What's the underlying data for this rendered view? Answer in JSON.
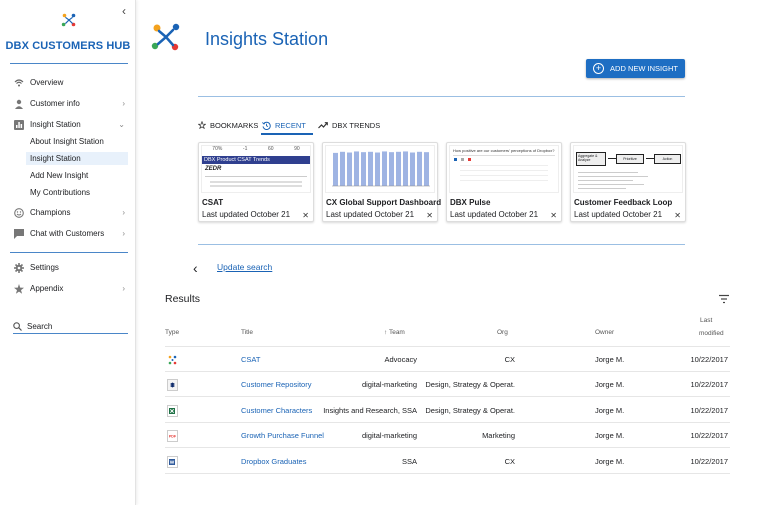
{
  "sidebar": {
    "title": "DBX CUSTOMERS HUB",
    "items": [
      {
        "label": "Overview",
        "icon": "wifi-icon"
      },
      {
        "label": "Customer info",
        "icon": "person-icon"
      },
      {
        "label": "Insight Station",
        "icon": "bar-chart-icon"
      },
      {
        "label": "Champions",
        "icon": "smiley-icon"
      },
      {
        "label": "Chat with Customers",
        "icon": "chat-icon"
      },
      {
        "label": "Settings",
        "icon": "gear-icon"
      },
      {
        "label": "Appendix",
        "icon": "star-icon"
      }
    ],
    "subitems": [
      "About Insight Station",
      "Insight Station",
      "Add New Insight",
      "My Contributions"
    ],
    "active_subitem": "Insight Station",
    "search_label": "Search"
  },
  "header": {
    "title": "Insights Station",
    "add_button": "ADD NEW INSIGHT"
  },
  "tabs": [
    {
      "label": "BOOKMARKS",
      "icon": "star-outline-icon"
    },
    {
      "label": "RECENT",
      "icon": "history-icon",
      "active": true
    },
    {
      "label": "DBX TRENDS",
      "icon": "trending-icon"
    }
  ],
  "cards": [
    {
      "title": "CSAT",
      "updated": "Last updated October 21",
      "thumb": {
        "head": "DBX Product CSAT Trends",
        "tag": "ZEDR",
        "stats": [
          "70%",
          "-1",
          "60",
          "90"
        ]
      }
    },
    {
      "title": "CX Global Support Dashboard",
      "updated": "Last updated October 21",
      "thumb": {
        "bars": [
          0.92,
          0.95,
          0.93,
          0.96,
          0.94,
          0.95,
          0.93,
          0.96,
          0.94,
          0.95,
          0.96,
          0.93,
          0.95,
          0.94
        ]
      }
    },
    {
      "title": "DBX Pulse",
      "updated": "Last updated October 21",
      "thumb": {
        "head": "How positive are our customers' perceptions of Dropbox?"
      }
    },
    {
      "title": "Customer Feedback Loop",
      "updated": "Last updated October 21",
      "thumb": {
        "steps": [
          "Aggregate & Analyze",
          "Prioritize",
          "Action"
        ]
      }
    }
  ],
  "update_search": "Update search",
  "results": {
    "title": "Results",
    "columns": {
      "type": "Type",
      "title": "Title",
      "team": "Team",
      "org": "Org",
      "owner": "Owner",
      "modified_1": "Last",
      "modified_2": "modified"
    },
    "rows": [
      {
        "type": "dropbox-logo-icon",
        "title": "CSAT",
        "team": "Advocacy",
        "org": "CX",
        "owner": "Jorge M.",
        "modified": "10/22/2017"
      },
      {
        "type": "dropbox-box-icon",
        "title": "Customer Repository",
        "team": "digital-marketing",
        "org": "Design, Strategy & Operat.",
        "owner": "Jorge M.",
        "modified": "10/22/2017"
      },
      {
        "type": "excel-icon",
        "title": "Customer Characters",
        "team": "Insights and Research, SSA",
        "org": "Design, Strategy & Operat.",
        "owner": "Jorge M.",
        "modified": "10/22/2017"
      },
      {
        "type": "pdf-icon",
        "title": "Growth Purchase Funnel",
        "team": "digital-marketing",
        "org": "Marketing",
        "owner": "Jorge M.",
        "modified": "10/22/2017"
      },
      {
        "type": "word-icon",
        "title": "Dropbox Graduates",
        "team": "SSA",
        "org": "CX",
        "owner": "Jorge M.",
        "modified": "10/22/2017"
      }
    ]
  },
  "colors": {
    "accent": "#1a63b5",
    "button": "#1e6ec3",
    "divider": "#9bbfe3"
  }
}
